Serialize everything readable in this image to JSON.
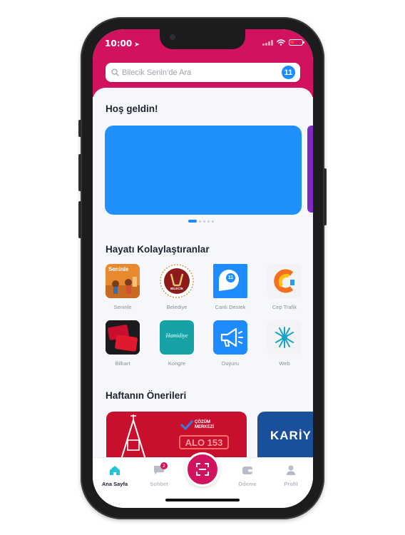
{
  "status_bar": {
    "time": "10:00"
  },
  "search": {
    "placeholder": "Bilecik Senin’de Ara",
    "badge": "11"
  },
  "welcome": {
    "title": "Hoş geldin!"
  },
  "carousel": {
    "page_count": 5,
    "active_index": 0
  },
  "quick_access": {
    "title": "Hayatı Kolaylaştıranlar",
    "items": [
      {
        "label": "Seninle",
        "tile_text": "Seninle"
      },
      {
        "label": "Belediye",
        "tile_text": "BİLECİK"
      },
      {
        "label": "Canlı Destek",
        "tile_text": "11"
      },
      {
        "label": "Cep Trafik"
      },
      {
        "label": "Bilkart"
      },
      {
        "label": "Kongre",
        "tile_text": "Hamidiye"
      },
      {
        "label": "Duyuru"
      },
      {
        "label": "Web"
      }
    ]
  },
  "suggestions": {
    "title": "Haftanın Önerileri",
    "cards": [
      {
        "brand": "ÇÖZÜM MERKEZİ",
        "text": "ALO 153"
      },
      {
        "text": "KARİY"
      }
    ]
  },
  "tabbar": {
    "tabs": [
      {
        "label": "Ana Sayfa",
        "active": true
      },
      {
        "label": "Sohbet",
        "badge": "2"
      },
      {
        "label": "Ödeme"
      },
      {
        "label": "Profil"
      }
    ]
  },
  "colors": {
    "brand": "#d3125f",
    "accent": "#1e8cff",
    "carousel_card": "#2090fb"
  }
}
